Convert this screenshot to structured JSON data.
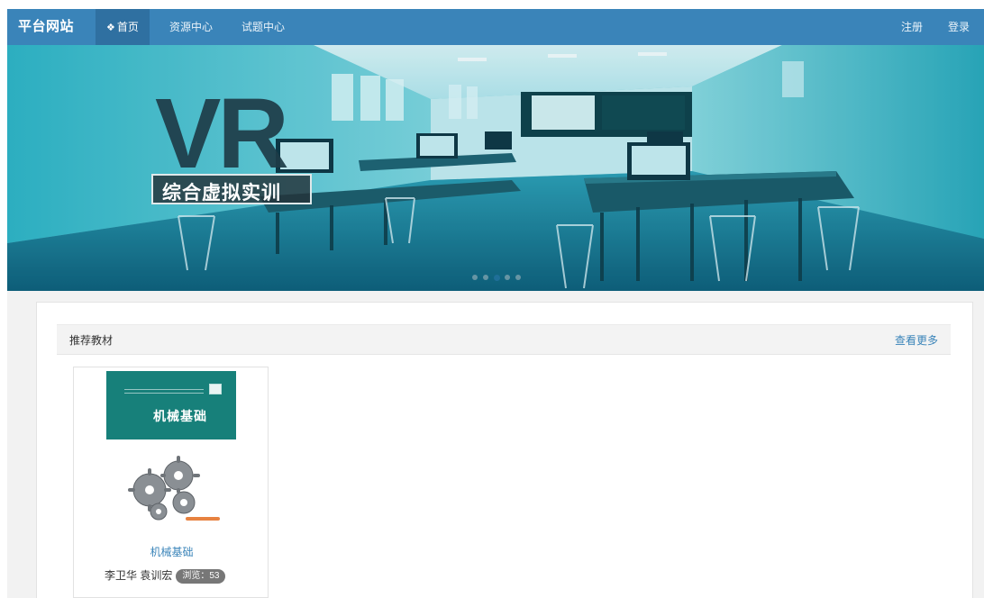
{
  "navbar": {
    "brand": "平台网站",
    "items": [
      {
        "label": "首页",
        "icon": "home-icon",
        "active": true
      },
      {
        "label": "资源中心",
        "active": false
      },
      {
        "label": "试题中心",
        "active": false
      }
    ],
    "right": {
      "register": "注册",
      "login": "登录"
    }
  },
  "banner": {
    "headline": "VR",
    "subtitle": "综合虚拟实训",
    "slide_count": 5,
    "active_slide": 3
  },
  "section": {
    "title": "推荐教材",
    "more_link": "查看更多"
  },
  "books": [
    {
      "cover_title": "机械基础",
      "title": "机械基础",
      "authors": "李卫华 袁训宏",
      "badge": "浏览：53"
    }
  ],
  "colors": {
    "navbar": "#3a84b9",
    "navbar_active": "#2f70a1",
    "link": "#3a84b9",
    "cover_green": "#17807a",
    "badge_gray": "#777777"
  }
}
